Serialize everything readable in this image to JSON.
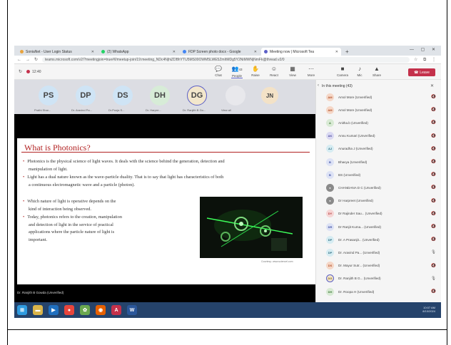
{
  "browser": {
    "tabs": [
      {
        "label": "SoniaNet - User Login Status",
        "icon_color": "#e8a33d"
      },
      {
        "label": "(2) WhatsApp",
        "icon_color": "#25d366"
      },
      {
        "label": "FDP Screen photo docx - Google",
        "icon_color": "#4285f4"
      },
      {
        "label": "Meeting now | Microsoft Tea",
        "icon_color": "#5b5fc7"
      }
    ],
    "url": "teams.microsoft.com/v2/?meetingjoin=true#/l/meetup-join/19:meeting_NDc4NjhiZDBhYTU5MS00OWM5LWE5ZmItMDg5Y2NiMWNjNmFk@thread.v2/0"
  },
  "meeting": {
    "timer": "12:40",
    "controls": [
      {
        "label": "Chat",
        "icon": "chat-icon",
        "glyph": "💬"
      },
      {
        "label": "People",
        "icon": "people-icon",
        "glyph": "👥",
        "badge": "43"
      },
      {
        "label": "Raise",
        "icon": "raise-hand-icon",
        "glyph": "✋"
      },
      {
        "label": "React",
        "icon": "react-icon",
        "glyph": "☺"
      },
      {
        "label": "View",
        "icon": "view-icon",
        "glyph": "▦"
      },
      {
        "label": "More",
        "icon": "more-icon",
        "glyph": "⋯"
      }
    ],
    "right_controls": [
      {
        "label": "Camera",
        "icon": "camera-icon",
        "glyph": "■"
      },
      {
        "label": "Mic",
        "icon": "mic-icon",
        "glyph": "♪"
      },
      {
        "label": "Share",
        "icon": "share-icon",
        "glyph": "▲"
      }
    ],
    "leave_label": "Leave",
    "accent": "#5b5fc7",
    "leave_color": "#c4314b"
  },
  "stage": {
    "avatars": [
      {
        "initials": "PS",
        "name": "Prathi Shar...",
        "bg": "#cfe4f5"
      },
      {
        "initials": "DP",
        "name": "Dr. Aravind Pa...",
        "bg": "#cfe4f5"
      },
      {
        "initials": "DS",
        "name": "Dr.Pooja S...",
        "bg": "#cfe4f5"
      },
      {
        "initials": "DH",
        "name": "Dr. Harpre...",
        "bg": "#d7ecd7"
      },
      {
        "initials": "DG",
        "name": "Dr. Ranjith B Go...",
        "bg": "#f3e7cc"
      },
      {
        "initials": "",
        "name": "View all",
        "bg": "#e8e8ec"
      }
    ],
    "presenter_avatar": {
      "initials": "JN",
      "bg": "#f3e2c7"
    },
    "nameplate": "Dr. Ranjith B Gowda (Unverified)"
  },
  "slide": {
    "title": "What is Photonics?",
    "bullets": [
      {
        "lines": [
          "Photonics is the physical science of light waves. It deals with the science behind the generation, detection and",
          "manipulation of light."
        ]
      },
      {
        "lines": [
          "Light has a dual nature known as the wave-particle duality. That is to say that light has characteristics of both",
          "a continuous electromagnetic wave and a particle (photon)."
        ]
      },
      {
        "lines": [
          "Which nature of light is operative depends on the",
          "kind of interaction being observed."
        ]
      },
      {
        "lines": [
          "Today, photonics refers to the creation, manipulation",
          "and detection of light in the service of practical",
          "applications where the particle nature of light is",
          "important."
        ]
      }
    ],
    "photo_credit": "Courtesy: www.sciencel.com"
  },
  "panel": {
    "title": "In this meeting (43)",
    "participants": [
      {
        "initials": "AM",
        "name": "Amol More (Unverified)",
        "bg": "#f5d7c7",
        "fg": "#b5532c",
        "mic": "muted"
      },
      {
        "initials": "AM",
        "name": "Amol More (Unverified)",
        "bg": "#f5d7c7",
        "fg": "#b5532c",
        "mic": "muted"
      },
      {
        "initials": "A",
        "name": "Anitha.b (Unverified)",
        "bg": "#d9ead5",
        "fg": "#3b7a35",
        "mic": "muted"
      },
      {
        "initials": "AK",
        "name": "Annu Kumari (Unverified)",
        "bg": "#dad9f2",
        "fg": "#4c4a9e",
        "mic": "muted"
      },
      {
        "initials": "AJ",
        "name": "Anuradha J (Unverified)",
        "bg": "#d6ecf2",
        "fg": "#2c6c80",
        "mic": "muted"
      },
      {
        "initials": "B",
        "name": "Bhavya (Unverified)",
        "bg": "#dde2f5",
        "fg": "#3f51a5",
        "mic": "muted"
      },
      {
        "initials": "B",
        "name": "BS (Unverified)",
        "bg": "#dde2f5",
        "fg": "#3f51a5",
        "mic": "muted"
      },
      {
        "initials": "",
        "name": "CHANDANA D C (Unverified)",
        "bg": "#8a8a8a",
        "fg": "#fff",
        "mic": "muted"
      },
      {
        "initials": "",
        "name": "Dr Harpreet (Unverified)",
        "bg": "#8a8a8a",
        "fg": "#fff",
        "mic": "muted"
      },
      {
        "initials": "DY",
        "name": "Dr Rajinder Sau... (Unverified)",
        "bg": "#f6d5d5",
        "fg": "#b23b3b",
        "mic": "muted"
      },
      {
        "initials": "DR",
        "name": "Dr Ranjit Kuma... (Unverified)",
        "bg": "#dde2f5",
        "fg": "#3f51a5",
        "mic": "muted"
      },
      {
        "initials": "DP",
        "name": "Dr. A Prasanjit... (Unverified)",
        "bg": "#d6ecf2",
        "fg": "#2c6c80",
        "mic": "muted"
      },
      {
        "initials": "DP",
        "name": "Dr. Aravind Pa... (Unverified)",
        "bg": "#d6ecf2",
        "fg": "#2c6c80",
        "mic": "on"
      },
      {
        "initials": "DS",
        "name": "Dr. Mayur Sutr... (Unverified)",
        "bg": "#f5d7c7",
        "fg": "#b5532c",
        "mic": "muted"
      },
      {
        "initials": "DG",
        "name": "Dr. Ranjith B G... (Unverified)",
        "bg": "#f3e7cc",
        "fg": "#8a6a1f",
        "mic": "on"
      },
      {
        "initials": "DH",
        "name": "Dr. Roopa H (Unverified)",
        "bg": "#d9ead5",
        "fg": "#3b7a35",
        "mic": "muted"
      }
    ]
  },
  "taskbar": {
    "apps": [
      {
        "icon": "start-icon",
        "color": "#2f9be0",
        "glyph": "⊞"
      },
      {
        "icon": "file-explorer-icon",
        "color": "#d9b44a",
        "glyph": "▬"
      },
      {
        "icon": "media-player-icon",
        "color": "#1f6fbf",
        "glyph": "▶"
      },
      {
        "icon": "chrome-icon",
        "color": "#e8453c",
        "glyph": "●"
      },
      {
        "icon": "settings-icon",
        "color": "#6aa84f",
        "glyph": "✿"
      },
      {
        "icon": "firefox-icon",
        "color": "#e66000",
        "glyph": "◉"
      },
      {
        "icon": "pdf-icon",
        "color": "#c4314b",
        "glyph": "A"
      },
      {
        "icon": "word-icon",
        "color": "#2b579a",
        "glyph": "W"
      }
    ],
    "time": "10:07 AM",
    "date": "8/10/2024"
  }
}
